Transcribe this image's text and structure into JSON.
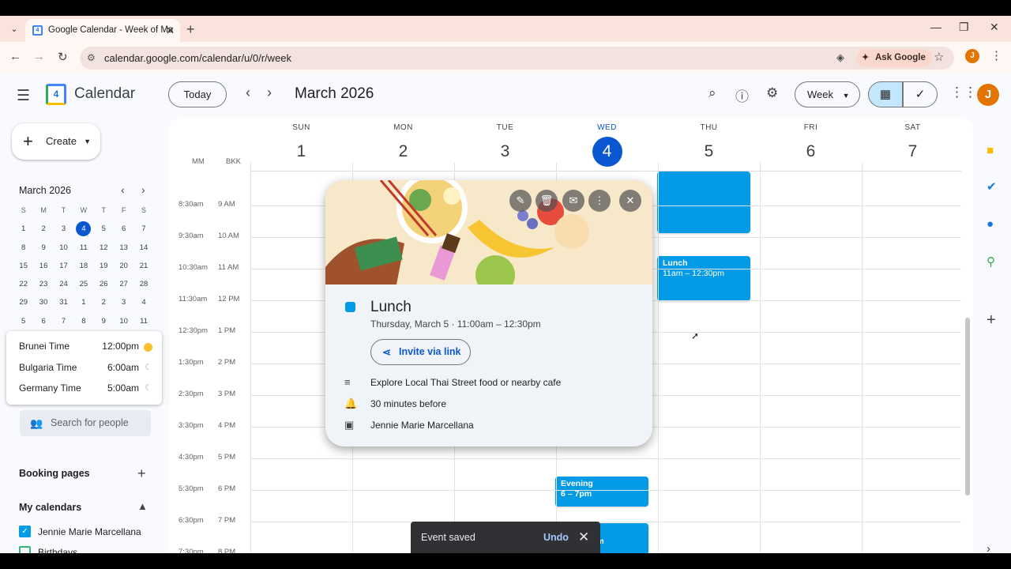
{
  "browser": {
    "tab_title": "Google Calendar - Week of Ma",
    "url": "calendar.google.com/calendar/u/0/r/week",
    "ask_google": "Ask Google",
    "profile_initial": "J"
  },
  "header": {
    "app_title": "Calendar",
    "logo_day": "4",
    "today_label": "Today",
    "month_label": "March 2026",
    "view_label": "Week",
    "avatar_initial": "J"
  },
  "sidebar": {
    "create_label": "Create",
    "mini_month": "March 2026",
    "weekday_heads": [
      "S",
      "M",
      "T",
      "W",
      "T",
      "F",
      "S"
    ],
    "mini_weeks": [
      [
        "1",
        "2",
        "3",
        "4",
        "5",
        "6",
        "7"
      ],
      [
        "8",
        "9",
        "10",
        "11",
        "12",
        "13",
        "14"
      ],
      [
        "15",
        "16",
        "17",
        "18",
        "19",
        "20",
        "21"
      ],
      [
        "22",
        "23",
        "24",
        "25",
        "26",
        "27",
        "28"
      ],
      [
        "29",
        "30",
        "31",
        "1",
        "2",
        "3",
        "4"
      ],
      [
        "5",
        "6",
        "7",
        "8",
        "9",
        "10",
        "11"
      ]
    ],
    "world_clock": [
      {
        "city": "Brunei Time",
        "time": "12:00pm"
      },
      {
        "city": "Bulgaria Time",
        "time": "6:00am"
      },
      {
        "city": "Germany Time",
        "time": "5:00am"
      }
    ],
    "search_people": "Search for people",
    "booking_pages": "Booking pages",
    "my_calendars": "My calendars",
    "calendars": [
      {
        "name": "Jennie Marie Marcellana",
        "checked": true
      },
      {
        "name": "Birthdays",
        "checked": false
      }
    ]
  },
  "week": {
    "days": [
      {
        "name": "SUN",
        "num": "1"
      },
      {
        "name": "MON",
        "num": "2"
      },
      {
        "name": "TUE",
        "num": "3"
      },
      {
        "name": "WED",
        "num": "4"
      },
      {
        "name": "THU",
        "num": "5"
      },
      {
        "name": "FRI",
        "num": "6"
      },
      {
        "name": "SAT",
        "num": "7"
      }
    ],
    "tz1": "MM",
    "tz2": "BKK",
    "times_primary": [
      "8:30am",
      "9:30am",
      "10:30am",
      "11:30am",
      "12:30pm",
      "1:30pm",
      "2:30pm",
      "3:30pm",
      "4:30pm",
      "5:30pm",
      "6:30pm",
      "7:30pm"
    ],
    "times_secondary": [
      "9 AM",
      "10 AM",
      "11 AM",
      "12 PM",
      "1 PM",
      "2 PM",
      "3 PM",
      "4 PM",
      "5 PM",
      "6 PM",
      "7 PM",
      "8 PM"
    ]
  },
  "events": {
    "lunch_title": "Lunch",
    "lunch_time": "11am – 12:30pm",
    "evening_title": "Evening",
    "evening_time": "6 – 7pm",
    "partial_time": "pm"
  },
  "popover": {
    "title": "Lunch",
    "date_line": "Thursday, March 5  ·  11:00am – 12:30pm",
    "invite_label": "Invite via link",
    "description": "Explore Local Thai Street food or nearby cafe",
    "reminder": "30 minutes before",
    "calendar_owner": "Jennie Marie Marcellana"
  },
  "snackbar": {
    "message": "Event saved",
    "undo": "Undo"
  },
  "colors": {
    "event": "#039be5",
    "today": "#0b57d0"
  }
}
